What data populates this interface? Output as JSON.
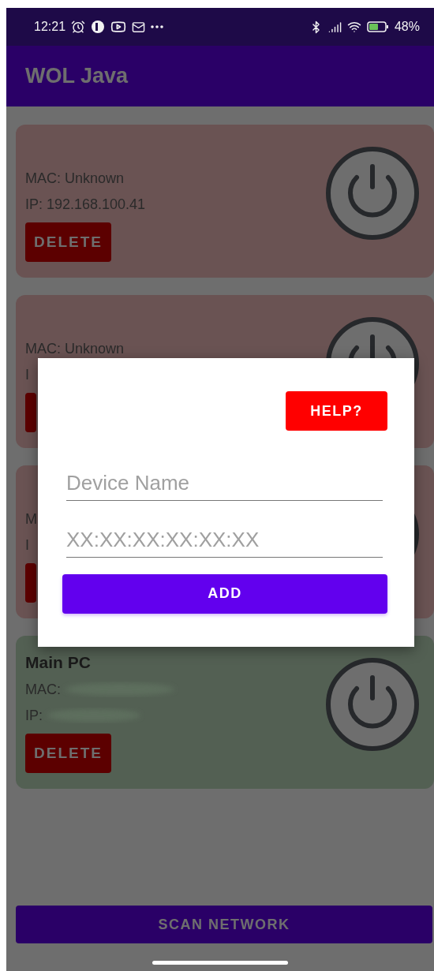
{
  "status_bar": {
    "time": "12:21",
    "battery": "48%"
  },
  "app_bar": {
    "title": "WOL Java"
  },
  "devices": [
    {
      "mac": "MAC: Unknown",
      "ip": "IP: 192.168.100.41",
      "delete": "DELETE",
      "color": "#6a5353"
    },
    {
      "mac": "MAC: Unknown",
      "ip": "I",
      "color": "#6a5353"
    },
    {
      "mac": "M",
      "ip": "I",
      "color": "#6a5353"
    },
    {
      "name": "Main PC",
      "mac": "MAC:",
      "ip": "IP:",
      "delete": "DELETE",
      "color": "#536053",
      "redacted": true
    }
  ],
  "scan_button": "SCAN NETWORK",
  "dialog": {
    "help_button": "HELP?",
    "fields": [
      {
        "placeholder": "Device Name"
      },
      {
        "placeholder": "XX:XX:XX:XX:XX:XX"
      }
    ],
    "add_button": "ADD"
  }
}
